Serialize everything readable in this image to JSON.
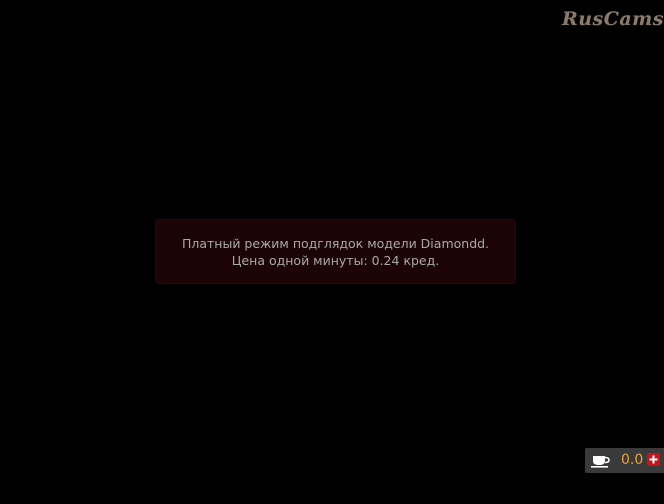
{
  "watermark": {
    "text": "RusCams"
  },
  "notice": {
    "line1": "Платный режим подглядок модели Diamondd.",
    "line2": "Цена одной минуты: 0.24 кред."
  },
  "balance": {
    "value": "0.0",
    "icon": "coffee-cup-icon",
    "add_icon": "plus-icon",
    "accent_color": "#e8a23a",
    "add_color": "#c8131a"
  }
}
